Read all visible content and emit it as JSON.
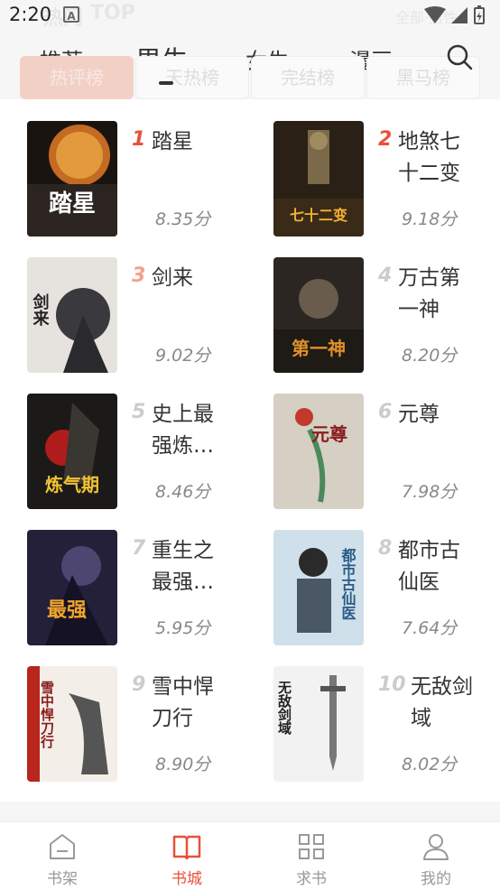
{
  "status_bar": {
    "time": "2:20",
    "notification_icon": "A",
    "icons": [
      "wifi-icon",
      "signal-icon",
      "battery-icon"
    ]
  },
  "background_header": {
    "left_text": "热门",
    "top_text": "TOP",
    "right_text": "全部·男性"
  },
  "top_nav": {
    "tabs": [
      {
        "label": "推荐"
      },
      {
        "label": "男生",
        "active": true
      },
      {
        "label": "女生"
      },
      {
        "label": "漫画"
      }
    ],
    "search_icon": "search-icon"
  },
  "rank_chips": [
    {
      "label": "热评榜",
      "active": true
    },
    {
      "label": "天热榜"
    },
    {
      "label": "完结榜"
    },
    {
      "label": "黑马榜"
    }
  ],
  "books": [
    {
      "rank": "1",
      "title": "踏星",
      "score": "8.35分",
      "cover_text": "踏星"
    },
    {
      "rank": "2",
      "title": "地煞七十二变",
      "score": "9.18分",
      "cover_text": "七十二变"
    },
    {
      "rank": "3",
      "title": "剑来",
      "score": "9.02分",
      "cover_text": "剑来"
    },
    {
      "rank": "4",
      "title": "万古第一神",
      "score": "8.20分",
      "cover_text": "第一神"
    },
    {
      "rank": "5",
      "title": "史上最强炼…",
      "score": "8.46分",
      "cover_text": "炼气期"
    },
    {
      "rank": "6",
      "title": "元尊",
      "score": "7.98分",
      "cover_text": "元尊"
    },
    {
      "rank": "7",
      "title": "重生之最强…",
      "score": "5.95分",
      "cover_text": "最强"
    },
    {
      "rank": "8",
      "title": "都市古仙医",
      "score": "7.64分",
      "cover_text": "都市古仙医"
    },
    {
      "rank": "9",
      "title": "雪中悍刀行",
      "score": "8.90分",
      "cover_text": "雪中悍刀行"
    },
    {
      "rank": "10",
      "title": "无敌剑域",
      "score": "8.02分",
      "cover_text": "无敌剑域"
    }
  ],
  "rank_colors": {
    "top": "#e8503a",
    "third": "#f4a08f",
    "rest": "#cccccc"
  },
  "bottom_tabs": [
    {
      "label": "书架",
      "icon": "bookshelf-icon"
    },
    {
      "label": "书城",
      "icon": "book-open-icon",
      "active": true
    },
    {
      "label": "求书",
      "icon": "grid-icon"
    },
    {
      "label": "我的",
      "icon": "user-icon"
    }
  ],
  "accent_color": "#e8503a"
}
